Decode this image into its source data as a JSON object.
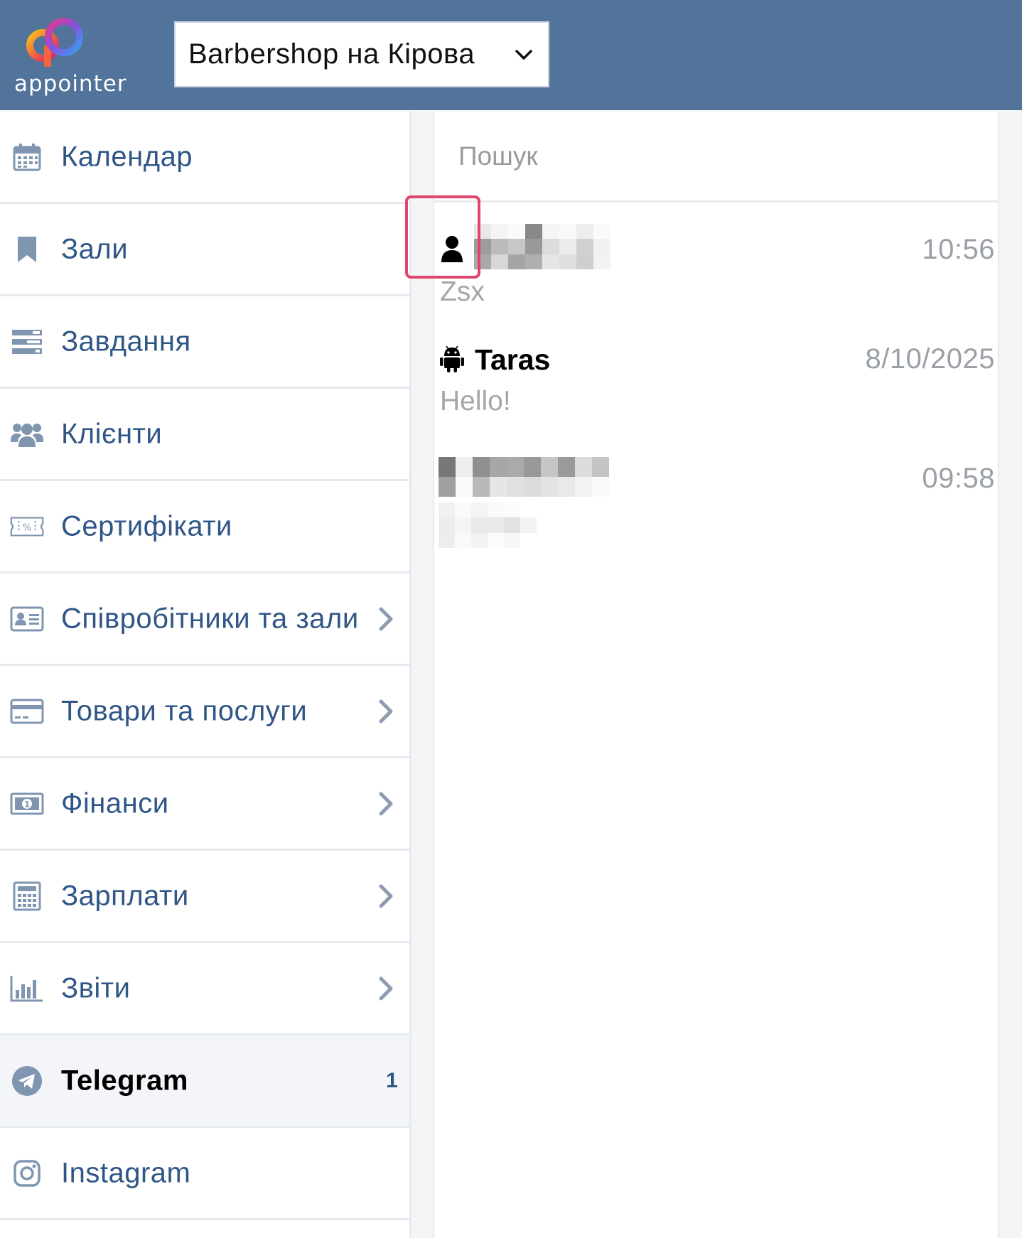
{
  "app": {
    "logo_text": "appointer",
    "branch_selector": "Barbershop на Кірова"
  },
  "sidebar": {
    "items": [
      {
        "label": "Календар",
        "icon": "calendar-icon"
      },
      {
        "label": "Зали",
        "icon": "bookmark-icon"
      },
      {
        "label": "Завдання",
        "icon": "tasks-icon"
      },
      {
        "label": "Клієнти",
        "icon": "users-icon"
      },
      {
        "label": "Сертифікати",
        "icon": "ticket-percent-icon"
      },
      {
        "label": "Співробітники та зали",
        "icon": "id-card-icon",
        "has_submenu": true
      },
      {
        "label": "Товари та послуги",
        "icon": "credit-card-icon",
        "has_submenu": true
      },
      {
        "label": "Фінанси",
        "icon": "money-icon",
        "has_submenu": true
      },
      {
        "label": "Зарплати",
        "icon": "calculator-icon",
        "has_submenu": true
      },
      {
        "label": "Звіти",
        "icon": "bar-chart-icon",
        "has_submenu": true
      },
      {
        "label": "Telegram",
        "icon": "telegram-icon",
        "active": true,
        "badge": "1"
      },
      {
        "label": "Instagram",
        "icon": "instagram-icon"
      }
    ]
  },
  "chats": {
    "search_placeholder": "Пошук",
    "items": [
      {
        "name": "",
        "source_icon": "user-icon",
        "time": "10:56",
        "message": "Zsx"
      },
      {
        "name": "Taras",
        "source_icon": "android-icon",
        "time": "8/10/2025",
        "message": "Hello!"
      },
      {
        "name": "",
        "source_icon": "",
        "time": "09:58",
        "message": ""
      }
    ]
  },
  "colors": {
    "header_bg": "#52739a",
    "nav_text": "#2f5686",
    "icon": "#7f95b0",
    "highlight": "#e0466b"
  }
}
